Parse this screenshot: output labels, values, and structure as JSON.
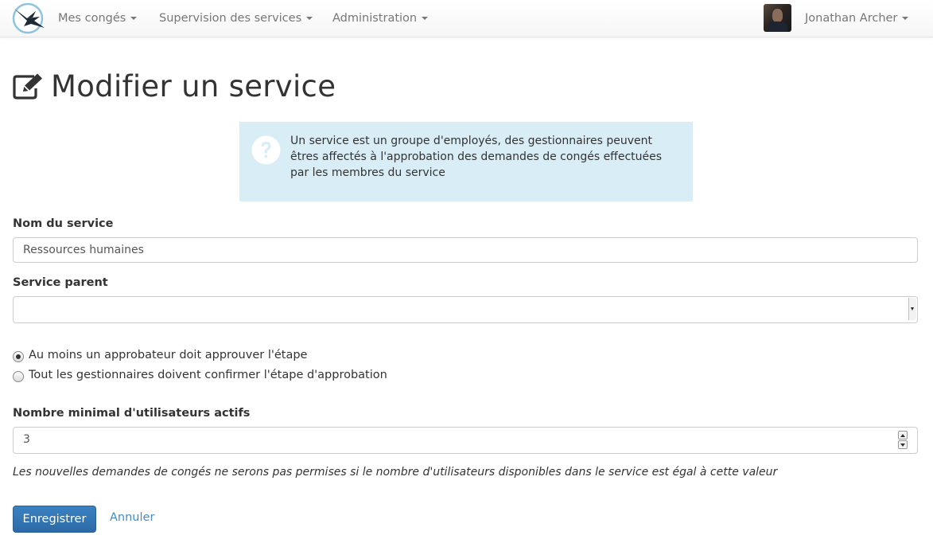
{
  "navbar": {
    "menus": [
      {
        "label": "Mes congés"
      },
      {
        "label": "Supervision des services"
      },
      {
        "label": "Administration"
      }
    ],
    "user_name": "Jonathan Archer"
  },
  "page": {
    "title": "Modifier un service"
  },
  "info": {
    "text": "Un service est un groupe d'employés, des gestionnaires peuvent êtres affectés à l'approbation des demandes de congés effectuées par les membres du service"
  },
  "form": {
    "name_label": "Nom du service",
    "name_value": "Ressources humaines",
    "parent_label": "Service parent",
    "parent_value": "",
    "radio_options": [
      {
        "label": "Au moins un approbateur doit approuver l'étape",
        "checked": true
      },
      {
        "label": "Tout les gestionnaires doivent confirmer l'étape d'approbation",
        "checked": false
      }
    ],
    "min_users_label": "Nombre minimal d'utilisateurs actifs",
    "min_users_value": "3",
    "min_users_help": "Les nouvelles demandes de congés ne serons pas permises si le nombre d'utilisateurs disponibles dans le service est égal à cette valeur",
    "save_label": "Enregistrer",
    "cancel_label": "Annuler"
  },
  "colors": {
    "primary": "#2c6aa6",
    "info_bg": "#d9edf7",
    "link": "#428bca"
  },
  "icons": {
    "brand": "swallow-logo-icon",
    "title": "edit-icon",
    "info": "question-circle-icon"
  }
}
